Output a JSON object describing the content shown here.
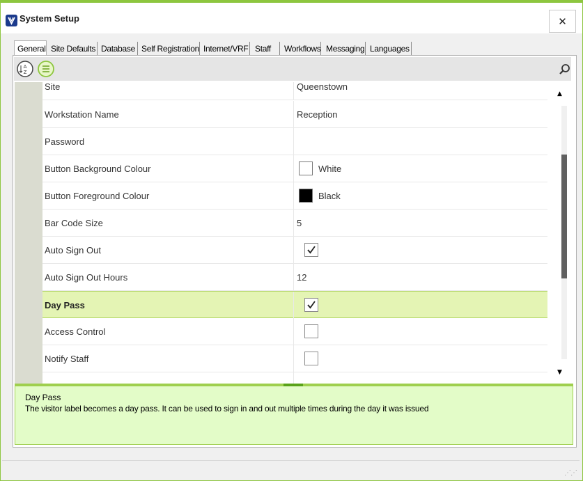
{
  "window": {
    "title": "System Setup",
    "close_label": "✕"
  },
  "tabs": [
    {
      "label": "General",
      "active": true
    },
    {
      "label": "Site Defaults"
    },
    {
      "label": "Database"
    },
    {
      "label": "Self Registration"
    },
    {
      "label": "Internet/VRF"
    },
    {
      "label": "Staff"
    },
    {
      "label": "Workflows"
    },
    {
      "label": "Messaging"
    },
    {
      "label": "Languages"
    }
  ],
  "toolbar": {
    "sort_alpha_icon": "sort-alphabetical-icon",
    "categorized_icon": "categorized-list-icon",
    "search_icon": "search-icon"
  },
  "properties": [
    {
      "name": "Site",
      "value": "Queenstown",
      "type": "text"
    },
    {
      "name": "Workstation Name",
      "value": "Reception",
      "type": "text"
    },
    {
      "name": "Password",
      "value": "",
      "type": "text"
    },
    {
      "name": "Button Background Colour",
      "value": "White",
      "type": "color",
      "swatch": "#ffffff"
    },
    {
      "name": "Button Foreground Colour",
      "value": "Black",
      "type": "color",
      "swatch": "#000000"
    },
    {
      "name": "Bar Code Size",
      "value": "5",
      "type": "text"
    },
    {
      "name": "Auto Sign Out",
      "checked": true,
      "type": "check"
    },
    {
      "name": "Auto Sign Out Hours",
      "value": "12",
      "type": "text"
    },
    {
      "name": "Day Pass",
      "checked": true,
      "type": "check",
      "selected": true
    },
    {
      "name": "Access Control",
      "checked": false,
      "type": "check"
    },
    {
      "name": "Notify Staff",
      "checked": false,
      "type": "check"
    }
  ],
  "description": {
    "title": "Day Pass",
    "text": "The visitor label becomes a day pass. It can be used to sign in and out multiple times during the day it was issued"
  },
  "colors": {
    "accent": "#8dc63f",
    "selected_row": "#e4f4b4",
    "description_bg": "#e3fcc8"
  }
}
